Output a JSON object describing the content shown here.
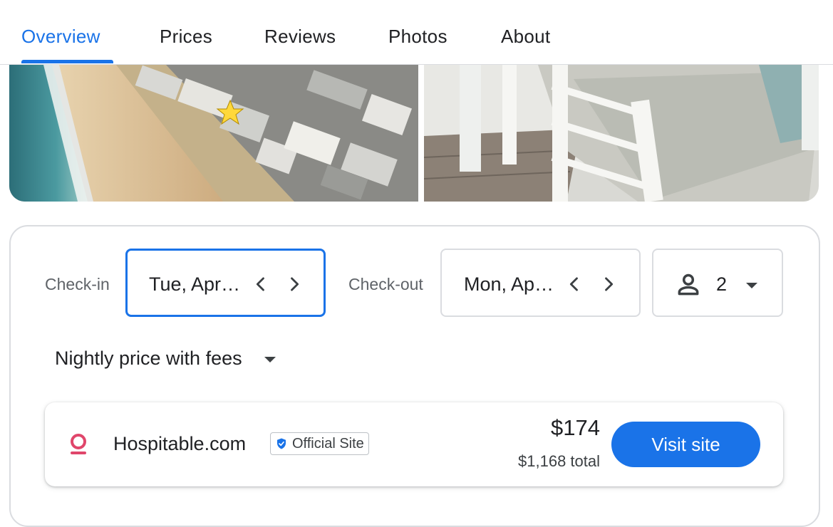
{
  "tabs": [
    {
      "label": "Overview",
      "active": true
    },
    {
      "label": "Prices"
    },
    {
      "label": "Reviews"
    },
    {
      "label": "Photos"
    },
    {
      "label": "About"
    }
  ],
  "booking": {
    "checkin_label": "Check-in",
    "checkin_value": "Tue, Apr…",
    "checkout_label": "Check-out",
    "checkout_value": "Mon, Ap…",
    "guests": "2",
    "price_mode": "Nightly price with fees"
  },
  "offer": {
    "provider": "Hospitable.com",
    "badge": "Official Site",
    "price": "$174",
    "total": "$1,168 total",
    "cta": "Visit site"
  },
  "colors": {
    "accent": "#1a73e8",
    "provider_logo": "#e0466b"
  },
  "icons": [
    "chevron-left-icon",
    "chevron-right-icon",
    "person-icon",
    "dropdown-caret-icon",
    "verified-shield-icon",
    "provider-logo-icon"
  ]
}
